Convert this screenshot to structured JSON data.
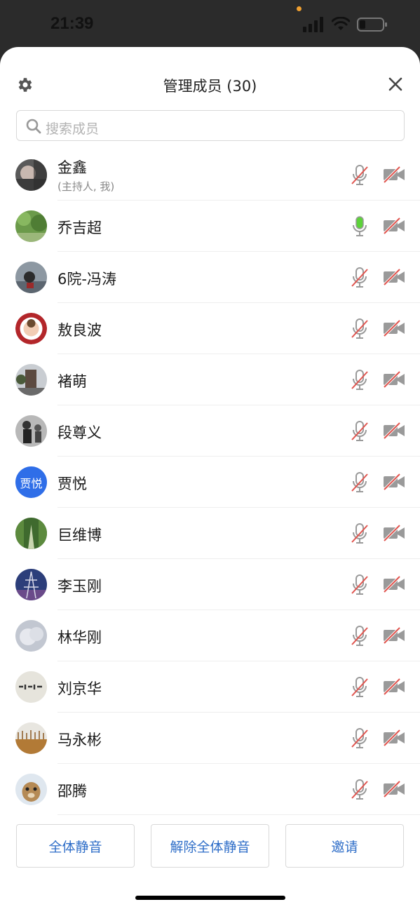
{
  "status_bar": {
    "time": "21:39"
  },
  "header": {
    "title": "管理成员 (30)"
  },
  "search": {
    "placeholder": "搜索成员"
  },
  "members": [
    {
      "name": "金鑫",
      "sub": "(主持人, 我)",
      "mic": "muted",
      "camera": "off",
      "avatar": "photo-dark"
    },
    {
      "name": "乔吉超",
      "sub": "",
      "mic": "active",
      "camera": "off",
      "avatar": "photo-green"
    },
    {
      "name": "6院-冯涛",
      "sub": "",
      "mic": "muted",
      "camera": "off",
      "avatar": "photo-street"
    },
    {
      "name": "敖良波",
      "sub": "",
      "mic": "muted",
      "camera": "off",
      "avatar": "photo-badge"
    },
    {
      "name": "褚萌",
      "sub": "",
      "mic": "muted",
      "camera": "off",
      "avatar": "photo-building"
    },
    {
      "name": "段尊义",
      "sub": "",
      "mic": "muted",
      "camera": "off",
      "avatar": "photo-people"
    },
    {
      "name": "贾悦",
      "sub": "",
      "mic": "muted",
      "camera": "off",
      "avatar": "initials",
      "initials": "贾悦"
    },
    {
      "name": "巨维博",
      "sub": "",
      "mic": "muted",
      "camera": "off",
      "avatar": "photo-trees"
    },
    {
      "name": "李玉刚",
      "sub": "",
      "mic": "muted",
      "camera": "off",
      "avatar": "photo-tower"
    },
    {
      "name": "林华刚",
      "sub": "",
      "mic": "muted",
      "camera": "off",
      "avatar": "photo-cloud"
    },
    {
      "name": "刘京华",
      "sub": "",
      "mic": "muted",
      "camera": "off",
      "avatar": "photo-calligraphy"
    },
    {
      "name": "马永彬",
      "sub": "",
      "mic": "muted",
      "camera": "off",
      "avatar": "photo-field"
    },
    {
      "name": "邵腾",
      "sub": "",
      "mic": "muted",
      "camera": "off",
      "avatar": "photo-dog"
    }
  ],
  "footer": {
    "mute_all": "全体静音",
    "unmute_all": "解除全体静音",
    "invite": "邀请"
  },
  "colors": {
    "accent_blue": "#2f6ec8",
    "mic_active": "#5dd23a",
    "muted_slash": "#e0554f",
    "icon_gray": "#9a9a9a"
  },
  "icons": {
    "settings": "gear-icon",
    "close": "close-icon",
    "search": "search-icon",
    "mic": "microphone-icon",
    "camera": "camera-off-icon"
  }
}
